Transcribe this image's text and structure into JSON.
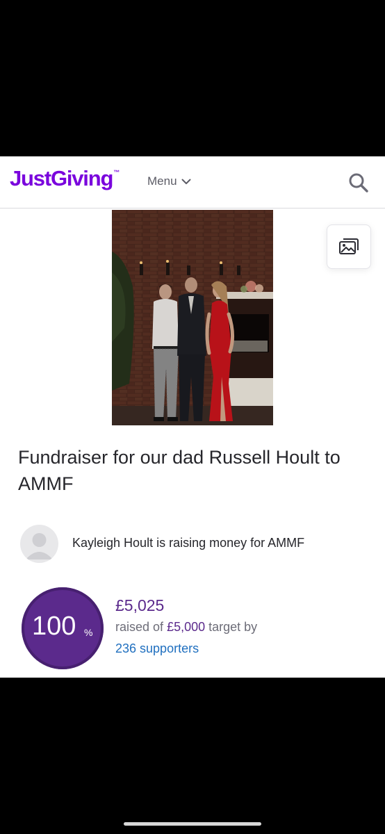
{
  "header": {
    "logo_text": "JustGiving",
    "logo_tm": "™",
    "menu_label": "Menu",
    "brand_color": "#7a04dd"
  },
  "icons": {
    "menu": "chevron-down-icon",
    "search": "search-icon",
    "gallery": "gallery-icon",
    "avatar": "user-avatar-icon"
  },
  "page": {
    "title": "Fundraiser for our dad Russell Hoult to AMMF",
    "organiser_text": "Kayleigh Hoult is raising money for AMMF"
  },
  "progress": {
    "percent": "100",
    "percent_sign": "%",
    "raised": "£5,025",
    "raised_prefix": "raised of",
    "target": "£5,000",
    "target_suffix": "target by",
    "supporters": "236 supporters",
    "accent_color": "#5b2a8c"
  }
}
